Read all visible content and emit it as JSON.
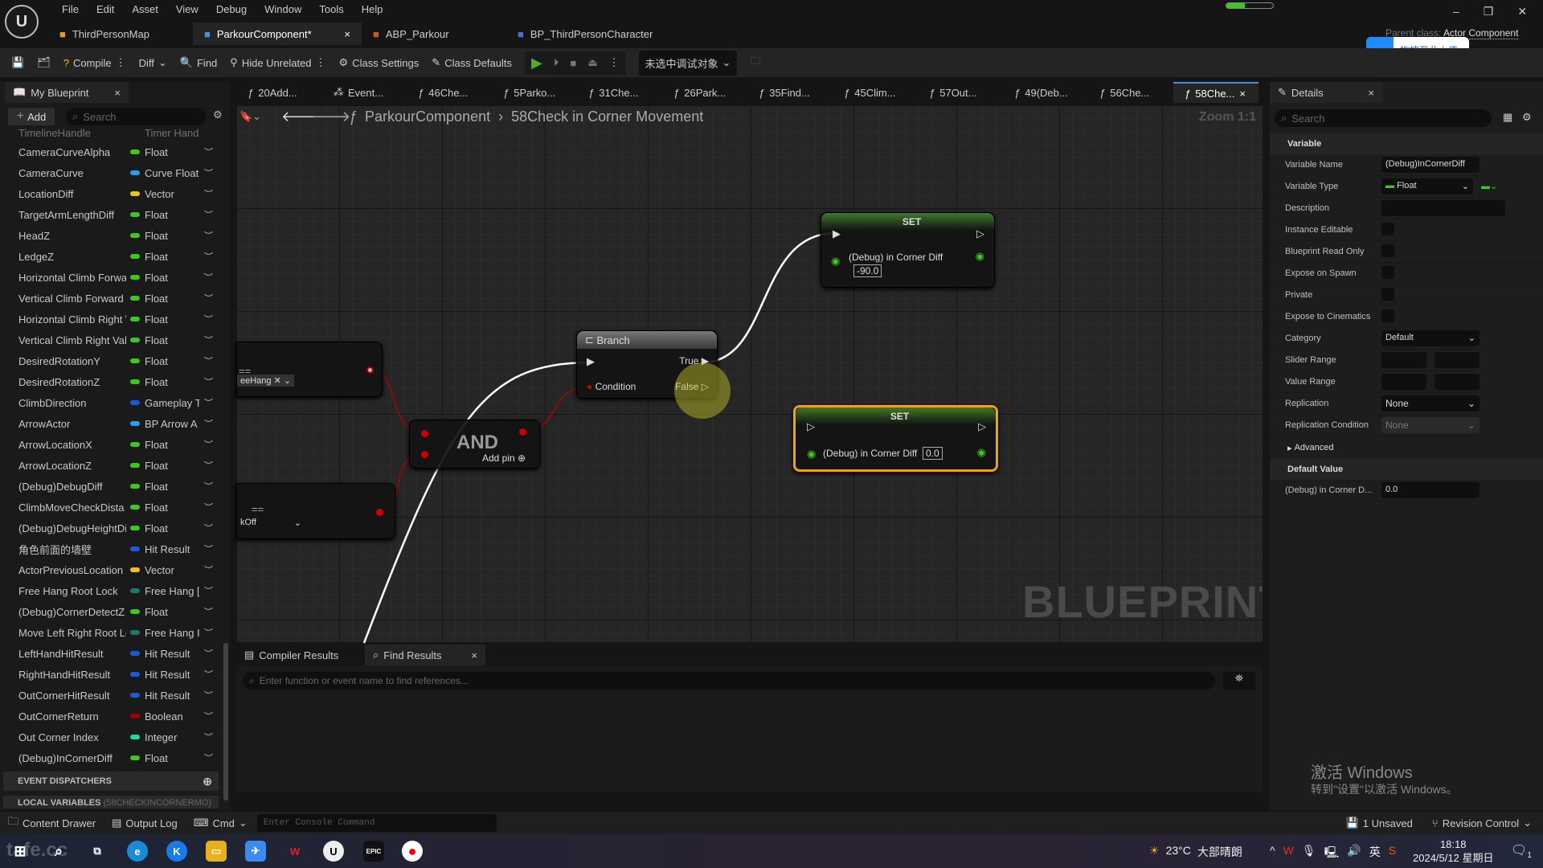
{
  "menu": [
    "File",
    "Edit",
    "Asset",
    "View",
    "Debug",
    "Window",
    "Tools",
    "Help"
  ],
  "doc_tabs": [
    {
      "label": "ThirdPersonMap",
      "icon": "level-icon",
      "color": "#e0a020"
    },
    {
      "label": "ParkourComponent*",
      "icon": "blueprint-icon",
      "color": "#4b8fd6",
      "active": true
    },
    {
      "label": "ABP_Parkour",
      "icon": "anim-blueprint-icon",
      "color": "#c06020"
    },
    {
      "label": "BP_ThirdPersonCharacter",
      "icon": "character-icon",
      "color": "#4b70c6"
    }
  ],
  "parent_class": {
    "label": "Parent class:",
    "value": "Actor Component"
  },
  "upload_badge": "拖拽至此上传",
  "toolbar": {
    "compile": "Compile",
    "diff": "Diff",
    "find": "Find",
    "hide_unrelated": "Hide Unrelated",
    "class_settings": "Class Settings",
    "class_defaults": "Class Defaults",
    "debug_select": "未选中调试对象"
  },
  "my_blueprint": {
    "title": "My Blueprint",
    "add": "Add",
    "search_placeholder": "Search",
    "partial_top": {
      "name": "TimelineHandle",
      "type": "Timer Hand"
    },
    "variables": [
      {
        "name": "CameraCurveAlpha",
        "type": "Float",
        "color": "#3cc81e"
      },
      {
        "name": "CameraCurve",
        "type": "Curve Float",
        "color": "#2a9cf0"
      },
      {
        "name": "LocationDiff",
        "type": "Vector",
        "color": "#f0c020"
      },
      {
        "name": "TargetArmLengthDiff",
        "type": "Float",
        "color": "#3cc81e"
      },
      {
        "name": "HeadZ",
        "type": "Float",
        "color": "#3cc81e"
      },
      {
        "name": "LedgeZ",
        "type": "Float",
        "color": "#3cc81e"
      },
      {
        "name": "Horizontal Climb Forwa",
        "type": "Float",
        "color": "#3cc81e"
      },
      {
        "name": "Vertical Climb Forward",
        "type": "Float",
        "color": "#3cc81e"
      },
      {
        "name": "Horizontal Climb Right \\",
        "type": "Float",
        "color": "#3cc81e"
      },
      {
        "name": "Vertical Climb Right Val",
        "type": "Float",
        "color": "#3cc81e"
      },
      {
        "name": "DesiredRotationY",
        "type": "Float",
        "color": "#3cc81e"
      },
      {
        "name": "DesiredRotationZ",
        "type": "Float",
        "color": "#3cc81e"
      },
      {
        "name": "ClimbDirection",
        "type": "Gameplay T",
        "color": "#1a5ad8"
      },
      {
        "name": "ArrowActor",
        "type": "BP Arrow A",
        "color": "#2a9cf0"
      },
      {
        "name": "ArrowLocationX",
        "type": "Float",
        "color": "#3cc81e"
      },
      {
        "name": "ArrowLocationZ",
        "type": "Float",
        "color": "#3cc81e"
      },
      {
        "name": "(Debug)DebugDiff",
        "type": "Float",
        "color": "#3cc81e"
      },
      {
        "name": "ClimbMoveCheckDista",
        "type": "Float",
        "color": "#3cc81e"
      },
      {
        "name": "(Debug)DebugHeightDi",
        "type": "Float",
        "color": "#3cc81e"
      },
      {
        "name": "角色前面的墙壁",
        "type": "Hit Result",
        "color": "#1a5ad8"
      },
      {
        "name": "ActorPreviousLocation",
        "type": "Vector",
        "color": "#f0c020"
      },
      {
        "name": "Free Hang Root Lock",
        "type": "Free Hang [",
        "color": "#1a7a6a"
      },
      {
        "name": "(Debug)CornerDetectZ",
        "type": "Float",
        "color": "#3cc81e"
      },
      {
        "name": "Move Left Right Root Lc",
        "type": "Free Hang I",
        "color": "#1a7a6a"
      },
      {
        "name": "LeftHandHitResult",
        "type": "Hit Result",
        "color": "#1a5ad8"
      },
      {
        "name": "RightHandHitResult",
        "type": "Hit Result",
        "color": "#1a5ad8"
      },
      {
        "name": "OutCornerHitResult",
        "type": "Hit Result",
        "color": "#1a5ad8"
      },
      {
        "name": "OutCornerReturn",
        "type": "Boolean",
        "color": "#a00000"
      },
      {
        "name": "Out Corner Index",
        "type": "Integer",
        "color": "#20d8a8"
      },
      {
        "name": "(Debug)InCornerDiff",
        "type": "Float",
        "color": "#3cc81e"
      }
    ],
    "event_dispatchers": "EVENT DISPATCHERS",
    "local_variables": "LOCAL VARIABLES",
    "local_variables_scope": "(58CHECKINCORNERMO)"
  },
  "graph_tabs": [
    "20Add...",
    "Event...",
    "46Che...",
    "5Parko...",
    "31Che...",
    "26Park...",
    "35Find...",
    "45Clim...",
    "57Out...",
    "49(Deb...",
    "56Che...",
    "58Che..."
  ],
  "breadcrumb": {
    "root": "ParkourComponent",
    "current": "58Check in Corner Movement"
  },
  "zoom": "Zoom 1:1",
  "watermark": "BLUEPRINT",
  "nodes": {
    "branch": {
      "title": "Branch",
      "true": "True",
      "false": "False",
      "condition": "Condition"
    },
    "and": {
      "title": "AND",
      "add_pin": "Add pin"
    },
    "set1": {
      "title": "SET",
      "pin": "(Debug) in Corner Diff",
      "value": "-90.0"
    },
    "set2": {
      "title": "SET",
      "pin": "(Debug) in Corner Diff",
      "value": "0.0"
    },
    "left1": {
      "enum": "eeHang"
    },
    "left2": {
      "enum": "kOff"
    }
  },
  "bottom": {
    "tabs": [
      "Compiler Results",
      "Find Results"
    ],
    "find_placeholder": "Enter function or event name to find references..."
  },
  "details": {
    "title": "Details",
    "search_placeholder": "Search",
    "section_variable": "Variable",
    "variable_name": {
      "label": "Variable Name",
      "value": "(Debug)InCornerDiff"
    },
    "variable_type": {
      "label": "Variable Type",
      "value": "Float"
    },
    "description": {
      "label": "Description",
      "value": ""
    },
    "checks": [
      {
        "label": "Instance Editable",
        "checked": false
      },
      {
        "label": "Blueprint Read Only",
        "checked": false
      },
      {
        "label": "Expose on Spawn",
        "checked": false
      },
      {
        "label": "Private",
        "checked": false
      },
      {
        "label": "Expose to Cinematics",
        "checked": false
      }
    ],
    "category": {
      "label": "Category",
      "value": "Default"
    },
    "slider_range": "Slider Range",
    "value_range": "Value Range",
    "replication": {
      "label": "Replication",
      "value": "None"
    },
    "replication_condition": {
      "label": "Replication Condition",
      "value": "None"
    },
    "advanced": "Advanced",
    "section_default": "Default Value",
    "default": {
      "label": "(Debug) in Corner D...",
      "value": "0.0"
    }
  },
  "activate_windows": {
    "title": "激活 Windows",
    "subtitle": "转到\"设置\"以激活 Windows。"
  },
  "statusbar": {
    "content_drawer": "Content Drawer",
    "output_log": "Output Log",
    "cmd": "Cmd",
    "console_placeholder": "Enter Console Command",
    "unsaved": "1 Unsaved",
    "revision_control": "Revision Control"
  },
  "taskbar": {
    "weather": "23°C",
    "weather_text": "大部晴朗",
    "ime": "英",
    "time": "18:18",
    "date": "2024/5/12 星期日",
    "notifications": "1",
    "watermark_logo": "tafe.cc"
  }
}
